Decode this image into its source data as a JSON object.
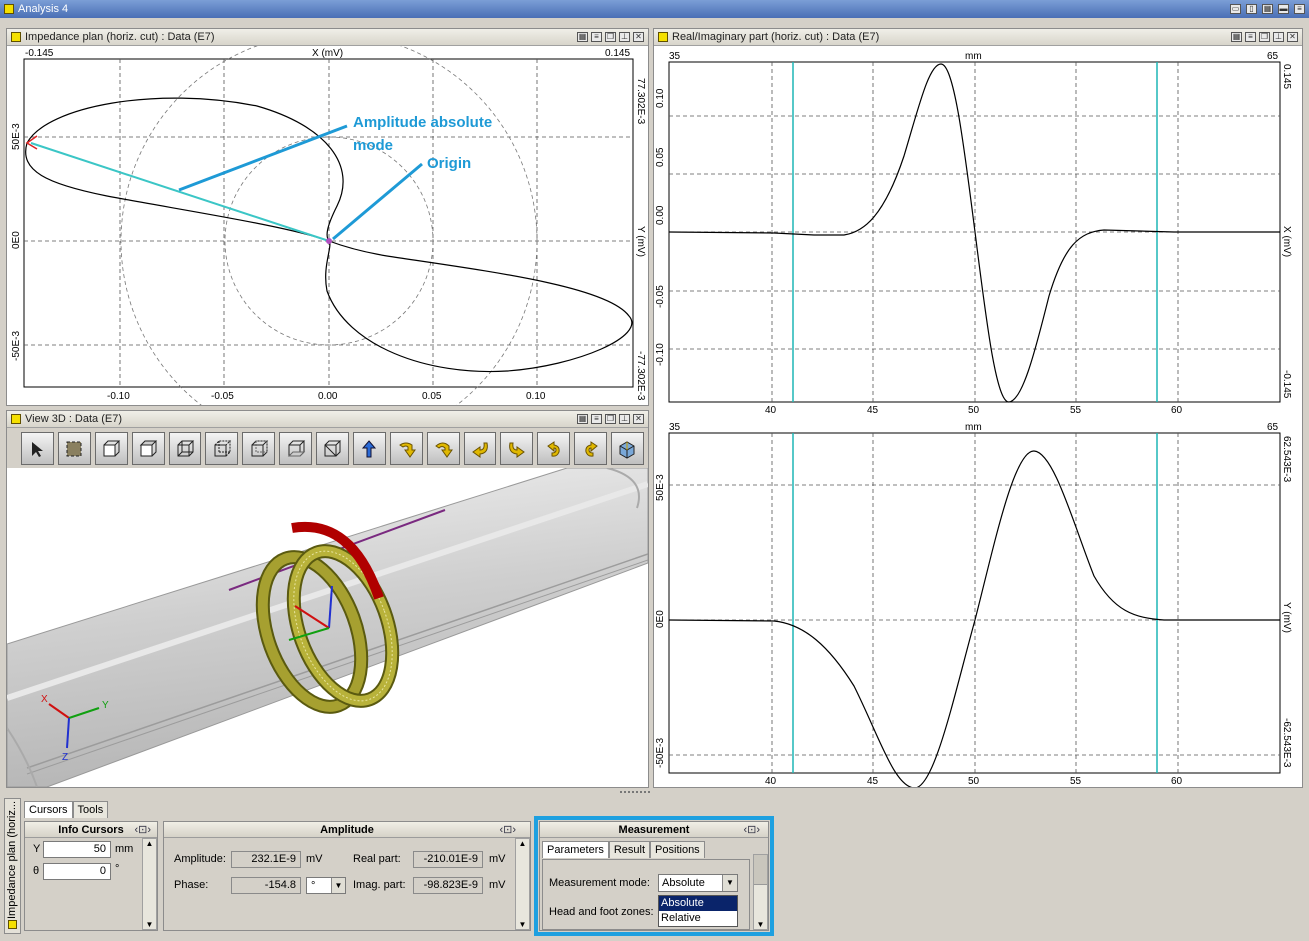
{
  "window": {
    "title": "Analysis 4"
  },
  "impedance": {
    "title": "Impedance plan (horiz. cut)  : Data (E7)",
    "x_axis_label": "X (mV)",
    "x_min_label": "-0.145",
    "x_max_label": "0.145",
    "y_axis_label": "Y (mV)",
    "y_top_label": "77.302E-3",
    "y_bottom_label": "-77.302E-3",
    "left_labels": [
      "50E-3",
      "0E0",
      "-50E-3"
    ],
    "bottom_ticks": [
      "-0.10",
      "-0.05",
      "0.00",
      "0.05",
      "0.10"
    ],
    "annotation_amplitude_line1": "Amplitude absolute",
    "annotation_amplitude_line2": "mode",
    "annotation_origin": "Origin"
  },
  "view3d": {
    "title": "View 3D  : Data (E7)",
    "toolbar": [
      "select-cursor-icon",
      "fit-view-icon",
      "cube-front-icon",
      "cube-top-icon",
      "cube-left-icon",
      "cube-right-icon",
      "cube-back-icon",
      "cube-bottom-icon",
      "cube-iso-icon",
      "arrow-up-icon",
      "rotate-down-icon",
      "rotate-down-right-icon",
      "rotate-left-icon",
      "rotate-right-icon",
      "rotate-ccw-icon",
      "rotate-cw-icon",
      "cube-perspective-icon"
    ],
    "axes": {
      "x": "X",
      "y": "Y",
      "z": "Z"
    }
  },
  "realimag": {
    "title": "Real/Imaginary part (horiz. cut)  : Data (E7)",
    "top": {
      "unit": "mm",
      "x_min": "35",
      "x_max": "65",
      "y_top_label": "0.145",
      "y_bottom_label": "-0.145",
      "y_axis_label": "X (mV)",
      "left_labels": [
        "0.10",
        "0.05",
        "0.00",
        "-0.05",
        "-0.10"
      ],
      "bottom_ticks": [
        "40",
        "45",
        "50",
        "55",
        "60"
      ]
    },
    "bottom": {
      "unit": "mm",
      "x_min": "35",
      "x_max": "65",
      "y_top_label": "62.543E-3",
      "y_bottom_label": "-62.543E-3",
      "y_axis_label": "Y (mV)",
      "left_labels": [
        "50E-3",
        "0E0",
        "-50E-3"
      ],
      "bottom_ticks": [
        "40",
        "45",
        "50",
        "55",
        "60"
      ]
    }
  },
  "bottom_panel": {
    "side_label": "Impedance plan (horiz...",
    "tabs": [
      "Cursors",
      "Tools"
    ],
    "info_cursors": {
      "title": "Info Cursors",
      "y_label": "Y",
      "y_value": "50",
      "y_unit": "mm",
      "theta_label": "θ",
      "theta_value": "0",
      "theta_unit": "°"
    },
    "amplitude": {
      "title": "Amplitude",
      "amplitude_label": "Amplitude:",
      "amplitude_value": "232.1E-9",
      "amplitude_unit": "mV",
      "phase_label": "Phase:",
      "phase_value": "-154.8",
      "phase_unit": "°",
      "real_label": "Real part:",
      "real_value": "-210.01E-9",
      "real_unit": "mV",
      "imag_label": "Imag. part:",
      "imag_value": "-98.823E-9",
      "imag_unit": "mV"
    },
    "measurement": {
      "title": "Measurement",
      "tabs": [
        "Parameters",
        "Result",
        "Positions"
      ],
      "mode_label": "Measurement mode:",
      "mode_value": "Absolute",
      "zones_label": "Head and foot zones:",
      "options": [
        "Absolute",
        "Relative"
      ]
    }
  },
  "colors": {
    "accent_cyan": "#1fb5b5",
    "annotation_blue": "#1e9ad6",
    "highlight_border": "#1ea0e0"
  }
}
